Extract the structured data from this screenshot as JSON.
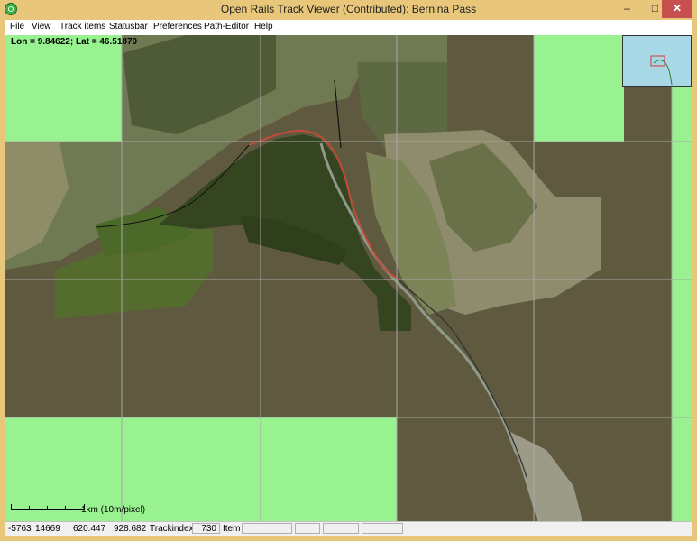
{
  "window": {
    "title": "Open Rails Track Viewer (Contributed): Bernina Pass",
    "min_label": "–",
    "max_label": "□",
    "close_label": "✕"
  },
  "menu": {
    "items": [
      "File",
      "View",
      "Track items",
      "Statusbar",
      "Preferences",
      "Path-Editor",
      "Help"
    ]
  },
  "map": {
    "coordinates": "Lon = 9.84622; Lat = 46.51870",
    "scale_label": "1km (10m/pixel)",
    "colors": {
      "background": "#5f5a3f",
      "empty_tile": "#98f28f",
      "forest_dark": "#34451f",
      "forest_mid": "#4a6a2e",
      "track": "#c44a3a",
      "grid": "#a8a8a8",
      "overview_water": "#a8d8e6"
    }
  },
  "statusbar": {
    "tile_x": "-5763",
    "tile_z": "14669",
    "x": "620.447",
    "z": "928.682",
    "trackindex_label": "Trackindex",
    "trackindex_value": "730",
    "item_label": "Item",
    "item_value": ""
  }
}
